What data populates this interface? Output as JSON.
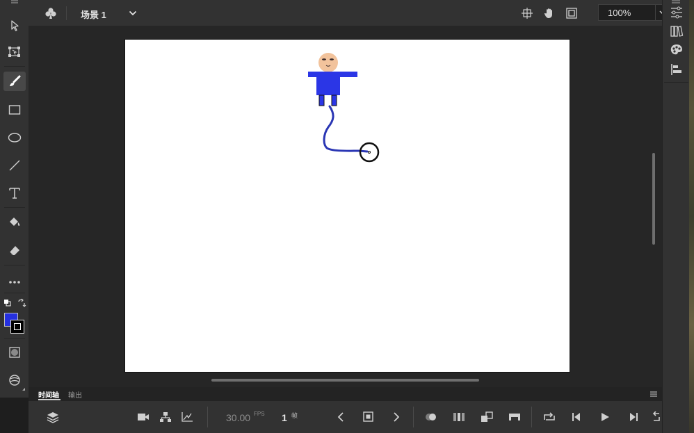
{
  "header": {
    "scene_label": "场景 1",
    "zoom_value": "100%"
  },
  "timeline": {
    "tabs": [
      {
        "label": "时间轴",
        "active": true
      },
      {
        "label": "输出",
        "active": false
      }
    ],
    "fps_value": "30.00",
    "fps_unit": "FPS",
    "frame_value": "1",
    "frame_unit": "帧"
  },
  "colors": {
    "stroke_color": "#ffffff",
    "fill_color": "#2530e0",
    "character_body": "#2b36e6",
    "character_head": "#f2c39c",
    "brush_stroke": "#2a36b4",
    "canvas_bg": "#ffffff"
  },
  "icons": {
    "left_toolbar": [
      "selection-arrow-icon",
      "free-transform-icon",
      "brush-icon",
      "rectangle-icon",
      "oval-icon",
      "line-icon",
      "text-icon",
      "paint-bucket-icon",
      "eraser-icon",
      "more-tools-icon",
      "default-colors-icon",
      "swap-colors-icon",
      "fill-color-swatch",
      "stroke-color-swatch",
      "object-drawing-icon",
      "asset-warp-icon"
    ],
    "right_panel": [
      "properties-icon",
      "library-icon",
      "swatches-icon",
      "align-icon"
    ]
  }
}
